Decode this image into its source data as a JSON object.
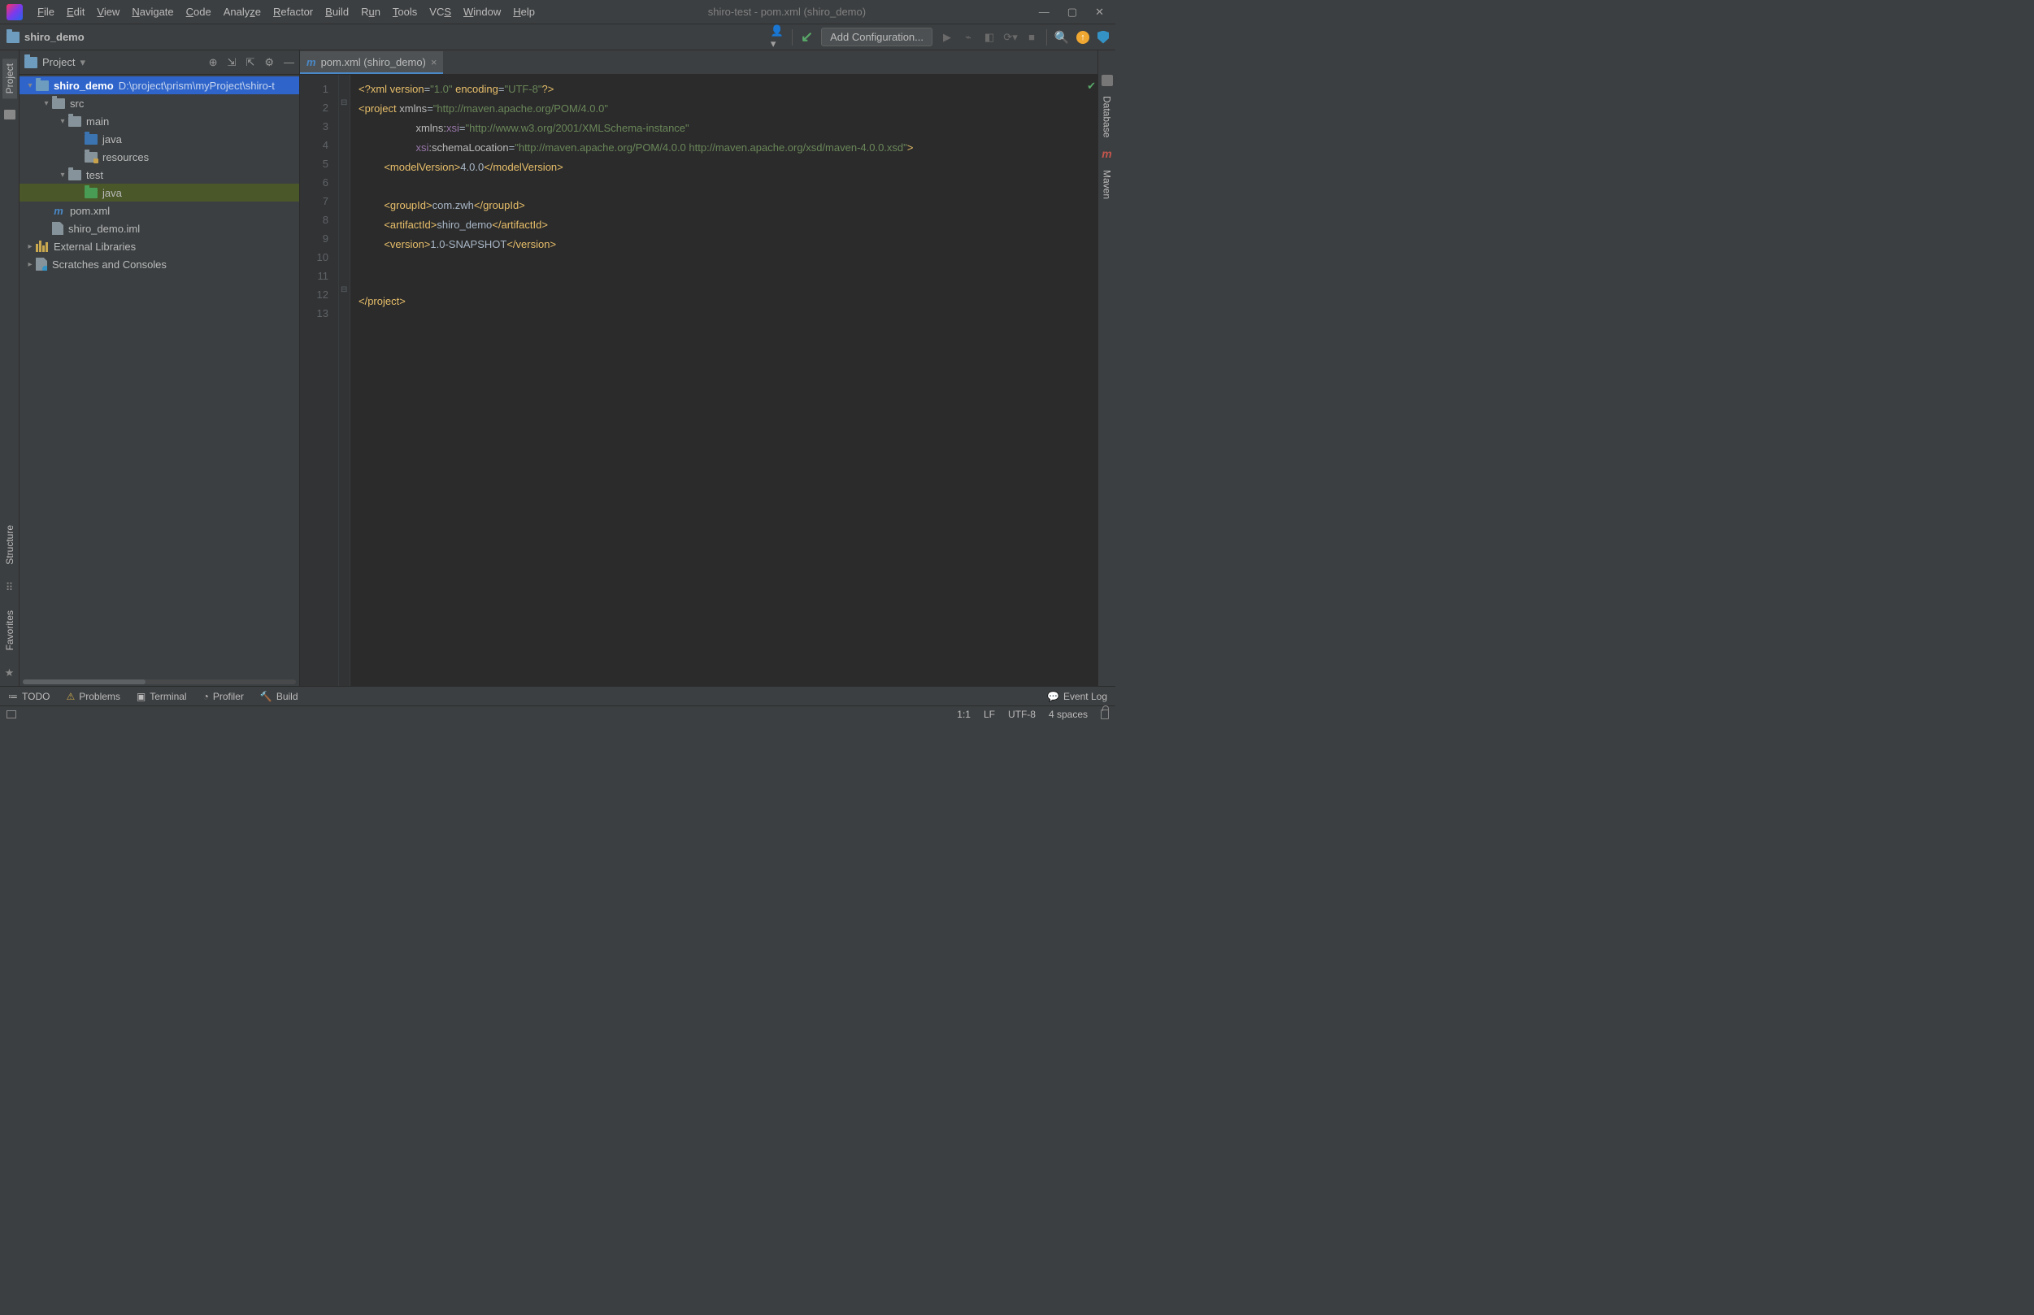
{
  "title": "shiro-test - pom.xml (shiro_demo)",
  "menus": [
    "File",
    "Edit",
    "View",
    "Navigate",
    "Code",
    "Analyze",
    "Refactor",
    "Build",
    "Run",
    "Tools",
    "VCS",
    "Window",
    "Help"
  ],
  "breadcrumb": "shiro_demo",
  "addConfig": "Add Configuration...",
  "projectPanel": {
    "title": "Project"
  },
  "tree": {
    "root": {
      "name": "shiro_demo",
      "path": "D:\\project\\prism\\myProject\\shiro-t"
    },
    "src": "src",
    "main": "main",
    "java_main": "java",
    "resources": "resources",
    "test": "test",
    "java_test": "java",
    "pom": "pom.xml",
    "iml": "shiro_demo.iml",
    "extlib": "External Libraries",
    "scratches": "Scratches and Consoles"
  },
  "tab": {
    "label": "pom.xml (shiro_demo)"
  },
  "lineNumbers": [
    "1",
    "2",
    "3",
    "4",
    "5",
    "6",
    "7",
    "8",
    "9",
    "10",
    "11",
    "12",
    "13"
  ],
  "code": {
    "l1a": "<?",
    "l1b": "xml version",
    "l1c": "=",
    "l1d": "\"1.0\"",
    "l1e": " encoding",
    "l1f": "=",
    "l1g": "\"UTF-8\"",
    "l1h": "?>",
    "l2a": "<project ",
    "l2b": "xmlns",
    "l2c": "=",
    "l2d": "\"http://maven.apache.org/POM/4.0.0\"",
    "l3a": "xmlns:",
    "l3b": "xsi",
    "l3c": "=",
    "l3d": "\"http://www.w3.org/2001/XMLSchema-instance\"",
    "l4a": "xsi",
    "l4b": ":schemaLocation",
    "l4c": "=",
    "l4d": "\"http://maven.apache.org/POM/4.0.0 http://maven.apache.org/xsd/maven-4.0.0.xsd\"",
    "l4e": ">",
    "l5a": "<modelVersion>",
    "l5b": "4.0.0",
    "l5c": "</modelVersion>",
    "l7a": "<groupId>",
    "l7b": "com.zwh",
    "l7c": "</groupId>",
    "l8a": "<artifactId>",
    "l8b": "shiro_demo",
    "l8c": "</artifactId>",
    "l9a": "<version>",
    "l9b": "1.0-SNAPSHOT",
    "l9c": "</version>",
    "l12a": "</project>"
  },
  "bottom": {
    "todo": "TODO",
    "problems": "Problems",
    "terminal": "Terminal",
    "profiler": "Profiler",
    "build": "Build",
    "eventlog": "Event Log"
  },
  "status": {
    "pos": "1:1",
    "sep": "LF",
    "enc": "UTF-8",
    "indent": "4 spaces"
  },
  "leftTabs": {
    "project": "Project",
    "structure": "Structure",
    "favorites": "Favorites"
  },
  "rightTabs": {
    "database": "Database",
    "maven": "Maven"
  }
}
